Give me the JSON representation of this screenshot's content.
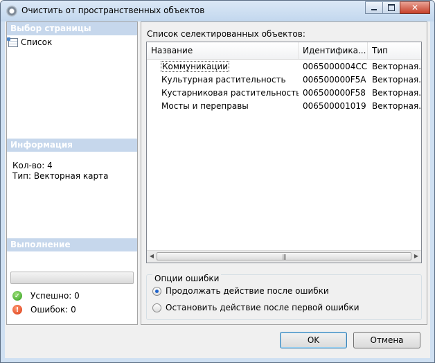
{
  "window": {
    "title": "Очистить от пространственных объектов",
    "icon": "gear-icon",
    "controls": {
      "minimize": "minimize",
      "maximize": "maximize",
      "close": "✕"
    }
  },
  "left": {
    "page_header": "Выбор страницы",
    "page_items": [
      {
        "label": "Список",
        "icon": "list-page-icon"
      }
    ],
    "info_header": "Информация",
    "info_count": "Кол-во: 4",
    "info_type": "Тип: Векторная карта",
    "progress_header": "Выполнение",
    "progress_value": 0,
    "success_label": "Успешно: 0",
    "error_label": "Ошибок: 0"
  },
  "main": {
    "list_caption": "Список селектированных объектов:",
    "columns": [
      "Название",
      "Идентифика...",
      "Тип"
    ],
    "rows": [
      {
        "name": "Коммуникации",
        "id": "0065000004CC",
        "type": "Векторная..."
      },
      {
        "name": "Культурная растительность",
        "id": "006500000F5A",
        "type": "Векторная..."
      },
      {
        "name": "Кустарниковая растительность",
        "id": "006500000F58",
        "type": "Векторная..."
      },
      {
        "name": "Мосты и переправы",
        "id": "006500001019",
        "type": "Векторная..."
      }
    ],
    "options_title": "Опции ошибки",
    "option_continue": "Продолжать действие после ошибки",
    "option_stop": "Остановить действие после первой ошибки",
    "selected_option": "continue"
  },
  "buttons": {
    "ok": "OK",
    "cancel": "Отмена"
  },
  "colors": {
    "section_header": "#c6d7ec",
    "accent": "#3c7fb1",
    "success": "#2f9d1d",
    "error": "#d9360f"
  }
}
